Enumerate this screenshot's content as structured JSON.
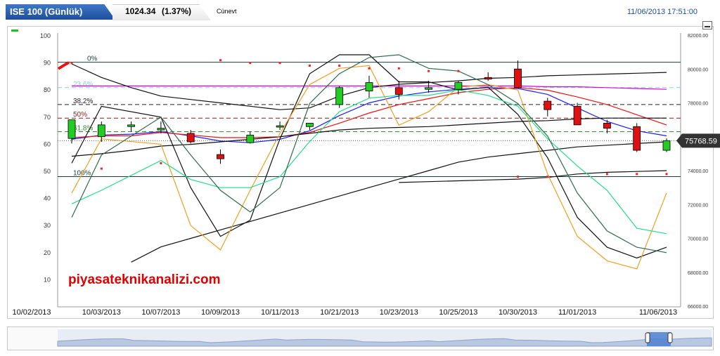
{
  "header": {
    "index_name": "ISE 100 (Günlük)",
    "price": "1024.34",
    "change": "(1.37%)",
    "period": "Cünevt",
    "datetime": "11/06/2013 17:51:00"
  },
  "watermark": "piyasateknikanalizi.com",
  "price_badge": "75768.59",
  "colors": {
    "up": "#22cc22",
    "down": "#dd1111",
    "watermark": "#e00000"
  },
  "chart_data": {
    "type": "line",
    "x": [
      "10/02/2013",
      "10/03/2013",
      "10/04/2013",
      "10/07/2013",
      "10/08/2013",
      "10/09/2013",
      "10/10/2013",
      "10/11/2013",
      "10/14/2013",
      "10/21/2013",
      "10/22/2013",
      "10/23/2013",
      "10/24/2013",
      "10/25/2013",
      "10/28/2013",
      "10/30/2013",
      "10/31/2013",
      "11/01/2013",
      "11/04/2013",
      "11/05/2013",
      "11/06/2013"
    ],
    "x_tick_labels": [
      "10/02/2013",
      "10/03/2013",
      "10/07/2013",
      "10/09/2013",
      "10/11/2013",
      "10/21/2013",
      "10/23/2013",
      "10/25/2013",
      "10/30/2013",
      "11/01/2013",
      "11/06/2013"
    ],
    "left_axis": {
      "ticks": [
        10,
        20,
        30,
        40,
        50,
        60,
        70,
        80,
        90,
        100
      ],
      "range": [
        0,
        100
      ]
    },
    "right_axis": {
      "ticks": [
        "66000.00",
        "68000.00",
        "70000.00",
        "72000.00",
        "74000.00",
        "76000.00",
        "78000.00",
        "80000.00",
        "82000.00"
      ],
      "range": [
        66000,
        82000
      ]
    },
    "fibonacci_levels": [
      {
        "label": "0%",
        "value": 80400,
        "color": "#1e3c3c"
      },
      {
        "label": "23.6%",
        "value": 78900,
        "color": "#88ccee"
      },
      {
        "label": "38.2%",
        "value": 77900,
        "color": "#222222"
      },
      {
        "label": "50%",
        "value": 77100,
        "color": "#8b1a1a"
      },
      {
        "label": "61.8%",
        "value": 76300,
        "color": "#2e8b2e"
      },
      {
        "label": "100%",
        "value": 73650,
        "color": "#1e3c3c"
      }
    ],
    "candles": [
      {
        "date": "10/02/2013",
        "open": 75900,
        "high": 77000,
        "low": 75600,
        "close": 77000
      },
      {
        "date": "10/03/2013",
        "open": 76000,
        "high": 76900,
        "low": 75700,
        "close": 76700
      },
      {
        "date": "10/04/2013",
        "open": 76600,
        "high": 76900,
        "low": 76300,
        "close": 76700
      },
      {
        "date": "10/07/2013",
        "open": 76400,
        "high": 76900,
        "low": 76200,
        "close": 76500
      },
      {
        "date": "10/08/2013",
        "open": 76200,
        "high": 76400,
        "low": 75600,
        "close": 75700
      },
      {
        "date": "10/09/2013",
        "open": 74950,
        "high": 75250,
        "low": 74400,
        "close": 74700
      },
      {
        "date": "10/10/2013",
        "open": 75650,
        "high": 76300,
        "low": 75600,
        "close": 76100
      },
      {
        "date": "10/11/2013",
        "open": 76600,
        "high": 76900,
        "low": 76400,
        "close": 76650
      },
      {
        "date": "10/14/2013",
        "open": 76600,
        "high": 76800,
        "low": 76400,
        "close": 76800
      },
      {
        "date": "10/21/2013",
        "open": 77900,
        "high": 79000,
        "low": 77700,
        "close": 78900
      },
      {
        "date": "10/22/2013",
        "open": 78700,
        "high": 79600,
        "low": 78300,
        "close": 79200
      },
      {
        "date": "10/23/2013",
        "open": 78900,
        "high": 79300,
        "low": 78200,
        "close": 78500
      },
      {
        "date": "10/24/2013",
        "open": 78800,
        "high": 79300,
        "low": 78600,
        "close": 78900
      },
      {
        "date": "10/25/2013",
        "open": 78800,
        "high": 79300,
        "low": 78500,
        "close": 79200
      },
      {
        "date": "10/28/2013",
        "open": 79500,
        "high": 79800,
        "low": 79300,
        "close": 79400
      },
      {
        "date": "10/30/2013",
        "open": 80000,
        "high": 80500,
        "low": 78900,
        "close": 78900
      },
      {
        "date": "10/31/2013",
        "open": 78100,
        "high": 78300,
        "low": 77200,
        "close": 77600
      },
      {
        "date": "11/01/2013",
        "open": 77800,
        "high": 78000,
        "low": 76700,
        "close": 76700
      },
      {
        "date": "11/04/2013",
        "open": 76800,
        "high": 77000,
        "low": 76200,
        "close": 76500
      },
      {
        "date": "11/05/2013",
        "open": 76600,
        "high": 76800,
        "low": 75100,
        "close": 75200
      },
      {
        "date": "11/06/2013",
        "open": 75200,
        "high": 75900,
        "low": 75100,
        "close": 75768.59
      }
    ],
    "series": [
      {
        "axis": "right",
        "color": "#1a1aff",
        "values": [
          75850,
          76100,
          76150,
          76300,
          76050,
          75750,
          75650,
          75850,
          76350,
          77250,
          78000,
          78400,
          78650,
          78800,
          78900,
          78850,
          78500,
          77700,
          76900,
          76350,
          76050
        ]
      },
      {
        "axis": "right",
        "color": "#ee1111",
        "values": [
          75950,
          76050,
          76050,
          76250,
          76100,
          75950,
          75950,
          76000,
          76250,
          76800,
          77400,
          77900,
          78250,
          78600,
          78800,
          78900,
          78750,
          78350,
          77900,
          77300,
          76700
        ]
      },
      {
        "axis": "right",
        "color": "#dd00dd",
        "values": [
          79000,
          79000,
          79000,
          79000,
          79000,
          79000,
          79000,
          79000,
          79000,
          79000,
          79000,
          79000,
          79000,
          79000,
          79000,
          79000,
          78950,
          78950,
          78900,
          78850,
          78800
        ]
      },
      {
        "axis": "right",
        "color": "#111111",
        "values": [
          74850,
          75000,
          75200,
          75450,
          75550,
          75700,
          75850,
          76000,
          76200,
          76400,
          76500,
          76550,
          76600,
          76700,
          76800,
          76900,
          76950,
          77050,
          77100,
          77100,
          77100
        ]
      },
      {
        "axis": "right",
        "color": "#111111",
        "values": [
          null,
          null,
          68600,
          69500,
          70000,
          70500,
          71000,
          71500,
          72000,
          72500,
          73000,
          73500,
          74000,
          74500,
          74800,
          75000,
          75200,
          75400,
          75500,
          75600,
          75700
        ]
      },
      {
        "axis": "right",
        "color": "#111111",
        "values": [
          null,
          null,
          null,
          null,
          null,
          null,
          null,
          null,
          null,
          null,
          null,
          73300,
          73350,
          73400,
          73450,
          73500,
          73600,
          73800,
          73900,
          73950,
          74000
        ]
      },
      {
        "axis": "right",
        "color": "#111111",
        "values": [
          80300,
          79500,
          78900,
          78400,
          78200,
          78000,
          77800,
          77600,
          77700,
          78400,
          78900,
          79100,
          79200,
          79300,
          79450,
          79500,
          79600,
          79650,
          79700,
          79750,
          79800
        ]
      },
      {
        "axis": "left",
        "color": "#111111",
        "values": [
          53,
          74,
          null,
          70,
          44,
          26,
          32,
          62,
          86,
          93,
          93,
          83,
          83,
          80,
          81,
          71,
          55,
          33,
          22,
          18,
          22
        ]
      },
      {
        "axis": "left",
        "color": "#f0a020",
        "values": [
          42,
          62,
          null,
          60,
          30,
          21,
          43,
          64,
          82,
          88,
          89,
          67,
          72,
          81,
          82,
          80,
          49,
          26,
          17,
          14,
          42
        ]
      },
      {
        "axis": "left",
        "color": "#20dd88",
        "values": [
          38,
          43,
          null,
          54,
          47,
          44,
          44,
          48,
          61,
          72,
          77,
          78,
          78,
          80,
          78,
          74,
          62,
          52,
          43,
          29,
          27
        ]
      },
      {
        "axis": "left",
        "color": "#2d6a4a",
        "values": [
          33,
          56,
          null,
          70,
          56,
          43,
          35,
          44,
          75,
          86,
          92,
          93,
          88,
          87,
          82,
          75,
          63,
          42,
          28,
          22,
          20
        ]
      }
    ],
    "markers": [
      {
        "date": "10/02/2013",
        "value": 90
      },
      {
        "date": "10/03/2013",
        "value": 51
      },
      {
        "date": "10/07/2013",
        "value": 53
      },
      {
        "date": "10/09/2013",
        "value": 91
      },
      {
        "date": "10/10/2013",
        "value": 90
      },
      {
        "date": "10/11/2013",
        "value": 90
      },
      {
        "date": "10/14/2013",
        "value": 89
      },
      {
        "date": "10/21/2013",
        "value": 89
      },
      {
        "date": "10/22/2013",
        "value": 88
      },
      {
        "date": "10/23/2013",
        "value": 88
      },
      {
        "date": "10/24/2013",
        "value": 87
      },
      {
        "date": "10/25/2013",
        "value": 87
      },
      {
        "date": "10/30/2013",
        "value": 48
      },
      {
        "date": "10/31/2013",
        "value": 48
      },
      {
        "date": "11/04/2013",
        "value": 49
      },
      {
        "date": "11/05/2013",
        "value": 49
      },
      {
        "date": "11/06/2013",
        "value": 49
      }
    ],
    "grid": false
  }
}
